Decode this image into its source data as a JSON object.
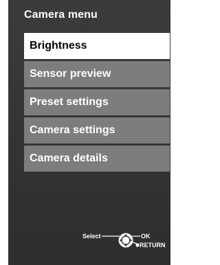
{
  "menu": {
    "title": "Camera menu",
    "items": [
      {
        "label": "Brightness",
        "selected": true
      },
      {
        "label": "Sensor preview",
        "selected": false
      },
      {
        "label": "Preset settings",
        "selected": false
      },
      {
        "label": "Camera settings",
        "selected": false
      },
      {
        "label": "Camera details",
        "selected": false
      }
    ]
  },
  "hints": {
    "select": "Select",
    "ok": "OK",
    "return": "RETURN",
    "dpad_icon": "remote-dpad-icon"
  },
  "colors": {
    "background": "#363837",
    "item_background": "#7c7e7d",
    "item_selected_background": "#ffffff",
    "item_selected_text": "#000000",
    "text": "#ffffff"
  }
}
